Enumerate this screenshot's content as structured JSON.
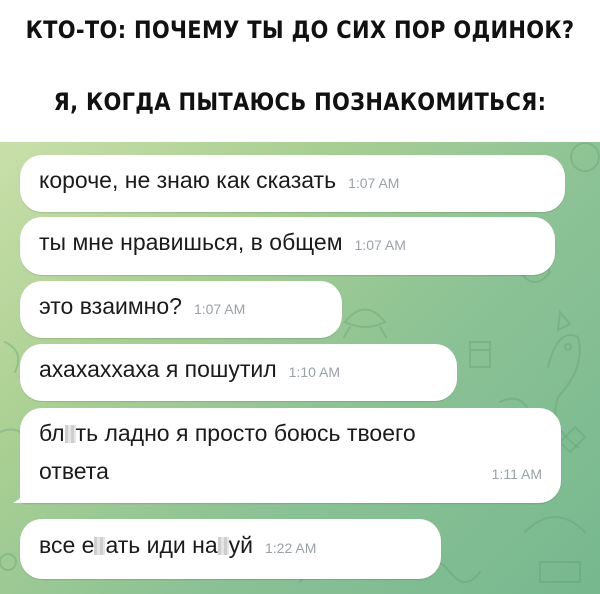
{
  "caption": {
    "line1": "КТО-ТО: ПОЧЕМУ ТЫ ДО СИХ ПОР ОДИНОК?",
    "line2": "Я, КОГДА ПЫТАЮСЬ ПОЗНАКОМИТЬСЯ:"
  },
  "messages": [
    {
      "text": "короче, не знаю как сказать",
      "time": "1:07 AM"
    },
    {
      "text": "ты мне нравишься, в общем",
      "time": "1:07 AM"
    },
    {
      "text": "это взаимно?",
      "time": "1:07 AM"
    },
    {
      "text": "ахахаххаха я пошутил",
      "time": "1:10 AM"
    },
    {
      "text_a": "бл",
      "text_b": "ть ладно я просто боюсь твоего",
      "text_line2": "ответа",
      "time": "1:11 AM"
    },
    {
      "text_a": "все е",
      "text_b": "ать иди на",
      "text_c": "уй",
      "time": "1:22 AM"
    }
  ],
  "colors": {
    "chat_bg_light": "#c9dfa9",
    "chat_bg_dark": "#77b88f",
    "bubble": "#ffffff",
    "time_text": "#9aa1a8"
  }
}
